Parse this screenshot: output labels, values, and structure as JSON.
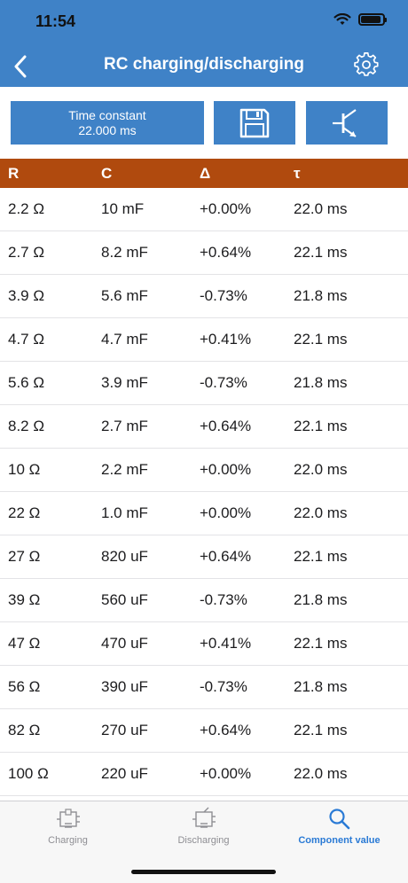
{
  "status": {
    "time": "11:54"
  },
  "nav": {
    "title": "RC charging/discharging",
    "back_icon": "chevron-left-icon",
    "settings_icon": "gear-icon"
  },
  "toolbar": {
    "time_constant_label": "Time constant",
    "time_constant_value": "22.000 ms",
    "save_icon": "floppy-disk-icon",
    "component_icon": "transistor-icon"
  },
  "table": {
    "headers": [
      "R",
      "C",
      "Δ",
      "τ"
    ],
    "rows": [
      [
        "2.2 Ω",
        "10 mF",
        "+0.00%",
        "22.0 ms"
      ],
      [
        "2.7 Ω",
        "8.2 mF",
        "+0.64%",
        "22.1 ms"
      ],
      [
        "3.9 Ω",
        "5.6 mF",
        "-0.73%",
        "21.8 ms"
      ],
      [
        "4.7 Ω",
        "4.7 mF",
        "+0.41%",
        "22.1 ms"
      ],
      [
        "5.6 Ω",
        "3.9 mF",
        "-0.73%",
        "21.8 ms"
      ],
      [
        "8.2 Ω",
        "2.7 mF",
        "+0.64%",
        "22.1 ms"
      ],
      [
        "10 Ω",
        "2.2 mF",
        "+0.00%",
        "22.0 ms"
      ],
      [
        "22 Ω",
        "1.0 mF",
        "+0.00%",
        "22.0 ms"
      ],
      [
        "27 Ω",
        "820 uF",
        "+0.64%",
        "22.1 ms"
      ],
      [
        "39 Ω",
        "560 uF",
        "-0.73%",
        "21.8 ms"
      ],
      [
        "47 Ω",
        "470 uF",
        "+0.41%",
        "22.1 ms"
      ],
      [
        "56 Ω",
        "390 uF",
        "-0.73%",
        "21.8 ms"
      ],
      [
        "82 Ω",
        "270 uF",
        "+0.64%",
        "22.1 ms"
      ],
      [
        "100 Ω",
        "220 uF",
        "+0.00%",
        "22.0 ms"
      ]
    ]
  },
  "tabs": [
    {
      "label": "Charging",
      "icon": "charging-circuit-icon",
      "active": false
    },
    {
      "label": "Discharging",
      "icon": "discharging-circuit-icon",
      "active": false
    },
    {
      "label": "Component value",
      "icon": "search-icon",
      "active": true
    }
  ],
  "colors": {
    "header": "#3f82c7",
    "table_header": "#b04a0e",
    "active_tab": "#2a7ad5",
    "inactive_tab": "#8e8e93"
  }
}
